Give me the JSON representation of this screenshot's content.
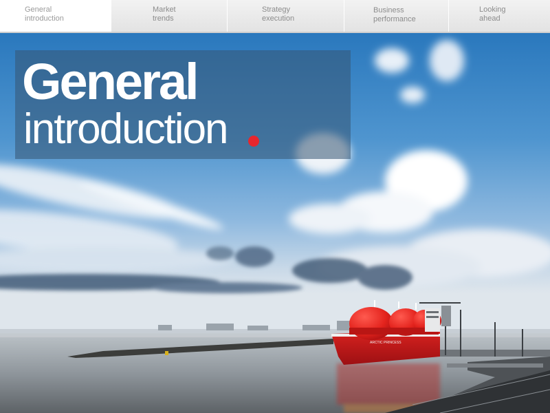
{
  "nav": {
    "tabs": [
      {
        "line1": "General",
        "line2": "introduction",
        "active": true
      },
      {
        "line1": "Market",
        "line2": "trends",
        "active": false
      },
      {
        "line1": "Strategy",
        "line2": "execution",
        "active": false
      },
      {
        "line1": "Business",
        "line2": "performance",
        "active": false
      },
      {
        "line1": "Looking",
        "line2": "ahead",
        "active": false
      }
    ]
  },
  "hero": {
    "title_line1": "General",
    "title_line2": "introduction",
    "ship_name": "ARCTIC PRINCESS",
    "colors": {
      "accent_dot": "#e8262d",
      "sky_top": "#2f7dc0",
      "hull": "#c8191c",
      "title_box": "#37557380"
    }
  }
}
